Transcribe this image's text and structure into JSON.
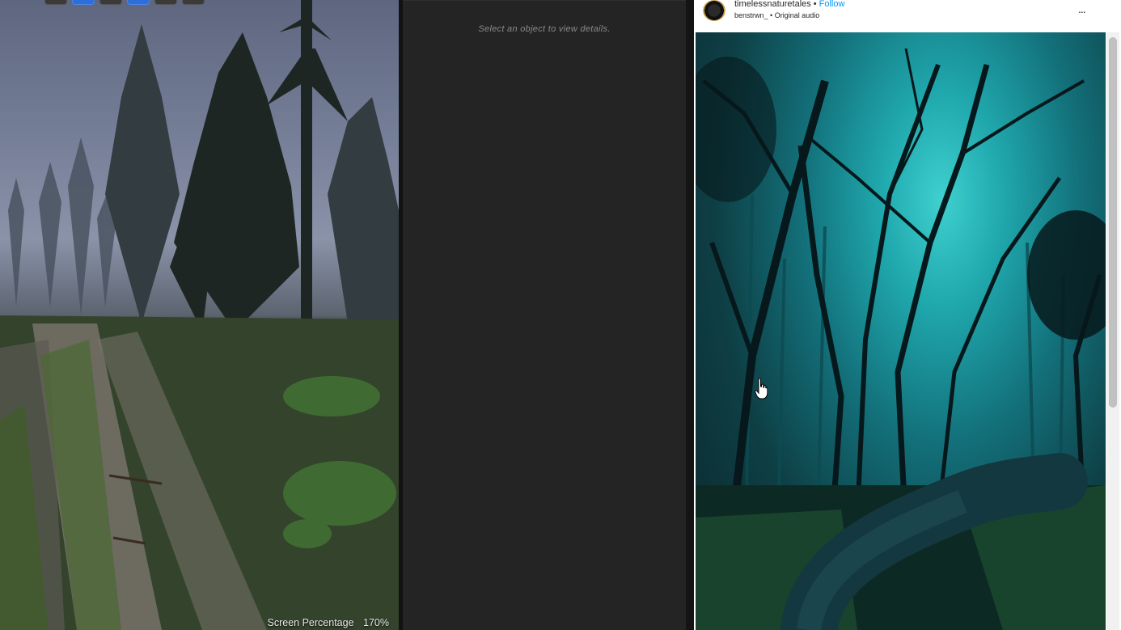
{
  "viewport": {
    "toolbar": {
      "active_indexes": [
        1,
        3
      ]
    },
    "status": {
      "label": "Screen Percentage",
      "value": "170%"
    }
  },
  "details": {
    "empty_hint": "Select an object to view details."
  },
  "post": {
    "username": "timelessnaturetales",
    "separator": "•",
    "follow_label": "Follow",
    "audio_user": "benstrwn_",
    "audio_separator": "•",
    "audio_label": "Original audio",
    "more_label": "...",
    "media": {
      "subject": "misty teal forest road"
    }
  },
  "colors": {
    "follow": "#0095f6",
    "panel_bg": "#242424",
    "viewport_toolbar_active": "#2f6ed8"
  },
  "icons": [
    "more-options-icon",
    "hand-cursor-icon",
    "avatar"
  ]
}
